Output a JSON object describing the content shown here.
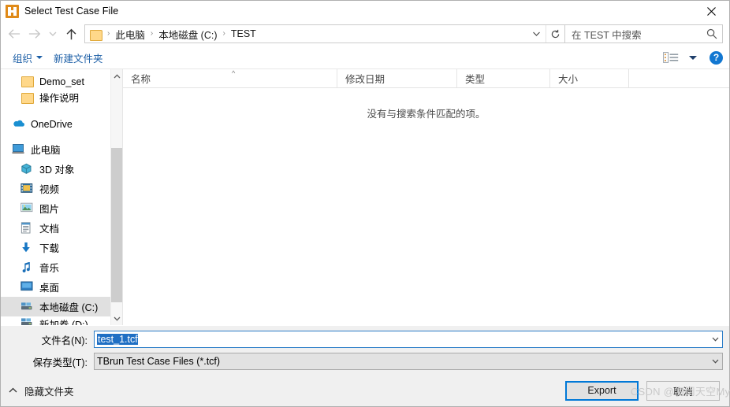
{
  "window": {
    "title": "Select Test Case File",
    "app_icon": "tbrun-app-icon",
    "close_icon": "close-icon"
  },
  "nav": {
    "back_icon": "arrow-left-icon",
    "forward_icon": "arrow-right-icon",
    "recent_icon": "chevron-down-icon",
    "up_icon": "arrow-up-icon",
    "breadcrumb_folder_icon": "folder-icon",
    "breadcrumbs": [
      "此电脑",
      "本地磁盘 (C:)",
      "TEST"
    ],
    "separator": "›",
    "address_dropdown_icon": "chevron-down-icon",
    "refresh_icon": "refresh-icon",
    "search_placeholder": "在 TEST 中搜索",
    "search_icon": "search-icon"
  },
  "toolbar": {
    "organize_label": "组织",
    "new_folder_label": "新建文件夹",
    "view_icon": "list-view-icon",
    "view_dropdown_icon": "chevron-down-icon",
    "help_icon": "help-icon",
    "help_label": "?"
  },
  "sidebar": {
    "items": [
      {
        "label": "Demo_set",
        "icon": "folder-icon",
        "indent": true,
        "selected": false,
        "clipped": true
      },
      {
        "label": "操作说明",
        "icon": "folder-icon",
        "indent": true,
        "selected": false,
        "clipped": false
      },
      {
        "label": "OneDrive",
        "icon": "onedrive-icon",
        "indent": false,
        "selected": false,
        "clipped": false
      },
      {
        "label": "此电脑",
        "icon": "computer-icon",
        "indent": false,
        "selected": false,
        "clipped": false
      },
      {
        "label": "3D 对象",
        "icon": "3d-objects-icon",
        "indent": true,
        "selected": false,
        "clipped": false
      },
      {
        "label": "视频",
        "icon": "videos-icon",
        "indent": true,
        "selected": false,
        "clipped": false
      },
      {
        "label": "图片",
        "icon": "pictures-icon",
        "indent": true,
        "selected": false,
        "clipped": false
      },
      {
        "label": "文档",
        "icon": "documents-icon",
        "indent": true,
        "selected": false,
        "clipped": false
      },
      {
        "label": "下载",
        "icon": "downloads-icon",
        "indent": true,
        "selected": false,
        "clipped": false
      },
      {
        "label": "音乐",
        "icon": "music-icon",
        "indent": true,
        "selected": false,
        "clipped": false
      },
      {
        "label": "桌面",
        "icon": "desktop-icon",
        "indent": true,
        "selected": false,
        "clipped": false
      },
      {
        "label": "本地磁盘 (C:)",
        "icon": "drive-icon",
        "indent": true,
        "selected": true,
        "clipped": false
      },
      {
        "label": "新加卷 (D:)",
        "icon": "drive-icon",
        "indent": true,
        "selected": false,
        "clipped": true
      }
    ],
    "scroll_up_icon": "chevron-up-icon",
    "scroll_down_icon": "chevron-down-icon"
  },
  "filelist": {
    "columns": [
      "名称",
      "修改日期",
      "类型",
      "大小"
    ],
    "sort_indicator": "^",
    "rows": [],
    "empty_message": "没有与搜索条件匹配的项。"
  },
  "form": {
    "filename_label": "文件名(N):",
    "filename_value": "test_1.tcf",
    "filename_selected": true,
    "filetype_label": "保存类型(T):",
    "filetype_value": "TBrun Test Case Files (*.tcf)",
    "dropdown_icon": "chevron-down-icon"
  },
  "footer": {
    "hide_folders_label": "隐藏文件夹",
    "hide_folders_icon": "chevron-up-icon",
    "export_label": "Export",
    "cancel_label": "取消",
    "watermark": "CSDN @海阔天空Myx"
  },
  "colors": {
    "accent": "#0078d7",
    "selection": "#1f6fc4",
    "link": "#1b5ea6",
    "app_icon": "#e08a18",
    "chrome": "#f0f0f0"
  }
}
